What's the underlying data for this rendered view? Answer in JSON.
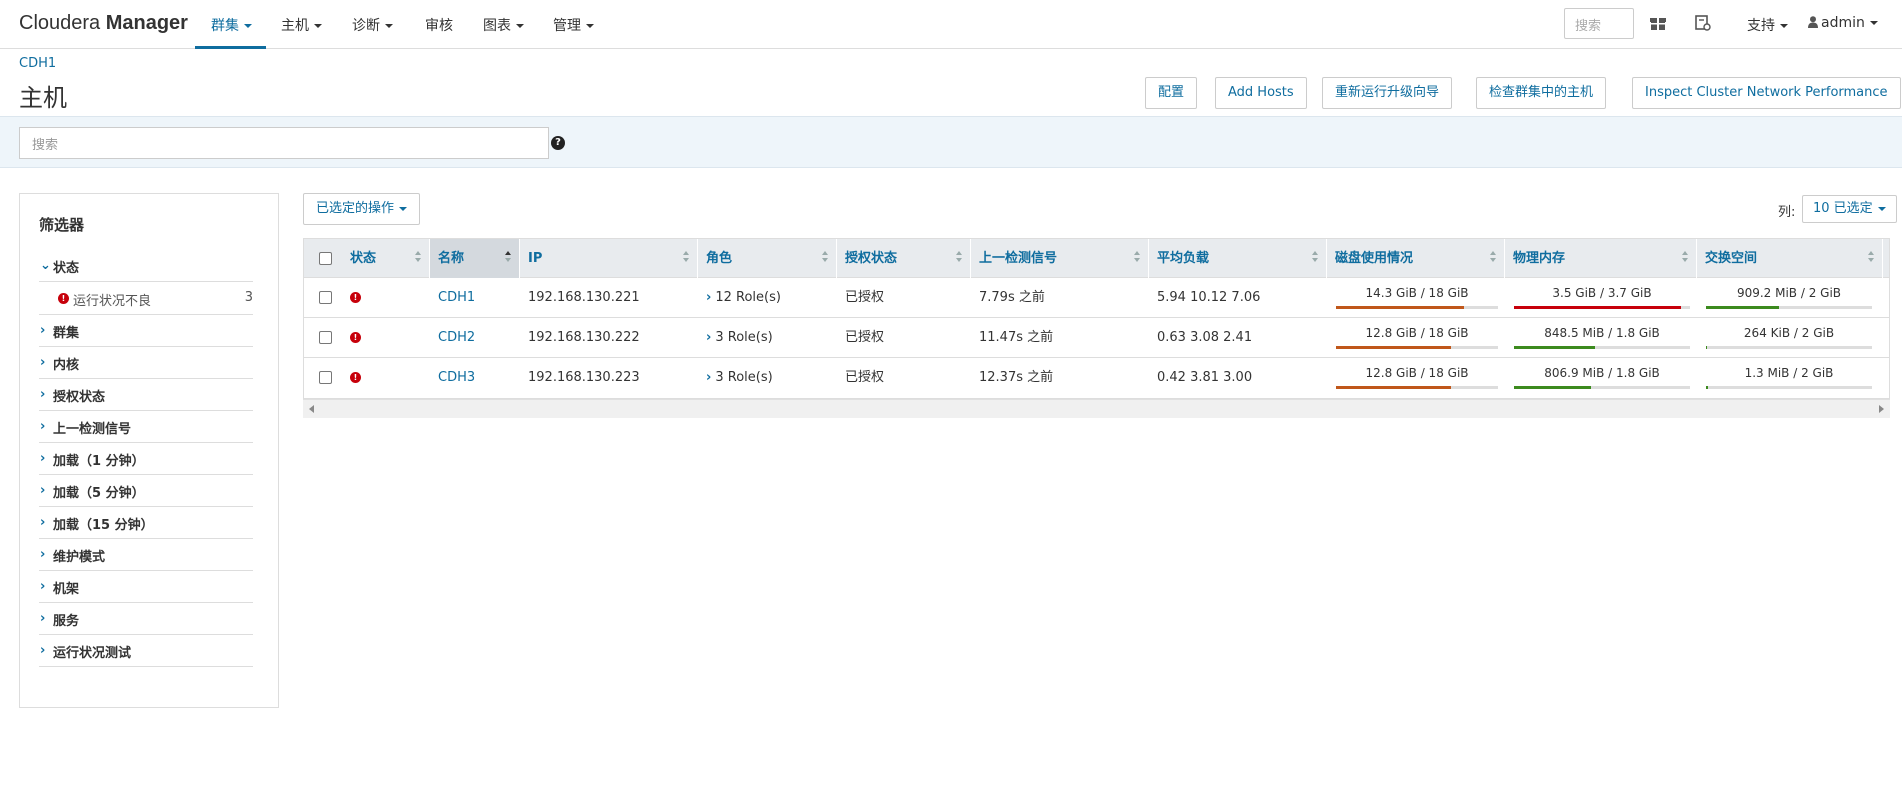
{
  "brand": {
    "light": "Cloudera ",
    "bold": "Manager"
  },
  "nav": {
    "items": [
      {
        "label": "群集",
        "has_caret": true,
        "active": true
      },
      {
        "label": "主机",
        "has_caret": true,
        "active": false
      },
      {
        "label": "诊断",
        "has_caret": true,
        "active": false
      },
      {
        "label": "审核",
        "has_caret": false,
        "active": false
      },
      {
        "label": "图表",
        "has_caret": true,
        "active": false
      },
      {
        "label": "管理",
        "has_caret": true,
        "active": false
      }
    ],
    "search_placeholder": "搜索",
    "support_label": "支持",
    "user_label": "admin"
  },
  "header": {
    "breadcrumb": "CDH1",
    "title": "主机",
    "buttons": [
      "配置",
      "Add Hosts",
      "重新运行升级向导",
      "检查群集中的主机",
      "Inspect Cluster Network Performance"
    ]
  },
  "search": {
    "placeholder": "搜索",
    "help_glyph": "?"
  },
  "filters": {
    "title": "筛选器",
    "status_label": "状态",
    "status_sub": {
      "label": "运行状况不良",
      "count": "3"
    },
    "items": [
      "群集",
      "内核",
      "授权状态",
      "上一检测信号",
      "加载（1 分钟）",
      "加载（5 分钟）",
      "加载（15 分钟）",
      "维护模式",
      "机架",
      "服务",
      "运行状况测试"
    ]
  },
  "toolbar": {
    "actions_label": "已选定的操作",
    "columns_label": "列:",
    "columns_value": "10 已选定"
  },
  "table": {
    "headers": [
      "状态",
      "名称",
      "IP",
      "角色",
      "授权状态",
      "上一检测信号",
      "平均负载",
      "磁盘使用情况",
      "物理内存",
      "交换空间"
    ],
    "rows": [
      {
        "name": "CDH1",
        "ip": "192.168.130.221",
        "roles": "12 Role(s)",
        "auth": "已授权",
        "heartbeat": "7.79s 之前",
        "load": "5.94  10.12  7.06",
        "disk": {
          "text": "14.3 GiB / 18 GiB",
          "fraction": 0.79,
          "color": "#c0571a"
        },
        "mem": {
          "text": "3.5 GiB / 3.7 GiB",
          "fraction": 0.95,
          "color": "#c7000b"
        },
        "swap": {
          "text": "909.2 MiB / 2 GiB",
          "fraction": 0.44,
          "color": "#3c8a1e"
        }
      },
      {
        "name": "CDH2",
        "ip": "192.168.130.222",
        "roles": "3 Role(s)",
        "auth": "已授权",
        "heartbeat": "11.47s 之前",
        "load": "0.63  3.08  2.41",
        "disk": {
          "text": "12.8 GiB / 18 GiB",
          "fraction": 0.71,
          "color": "#c0571a"
        },
        "mem": {
          "text": "848.5 MiB / 1.8 GiB",
          "fraction": 0.46,
          "color": "#3c8a1e"
        },
        "swap": {
          "text": "264 KiB / 2 GiB",
          "fraction": 0.0,
          "color": "#3c8a1e"
        }
      },
      {
        "name": "CDH3",
        "ip": "192.168.130.223",
        "roles": "3 Role(s)",
        "auth": "已授权",
        "heartbeat": "12.37s 之前",
        "load": "0.42  3.81  3.00",
        "disk": {
          "text": "12.8 GiB / 18 GiB",
          "fraction": 0.71,
          "color": "#c0571a"
        },
        "mem": {
          "text": "806.9 MiB / 1.8 GiB",
          "fraction": 0.44,
          "color": "#3c8a1e"
        },
        "swap": {
          "text": "1.3 MiB / 2 GiB",
          "fraction": 0.01,
          "color": "#3c8a1e"
        }
      }
    ]
  },
  "colors": {
    "accent": "#0f6d9f",
    "error": "#c7000b"
  }
}
